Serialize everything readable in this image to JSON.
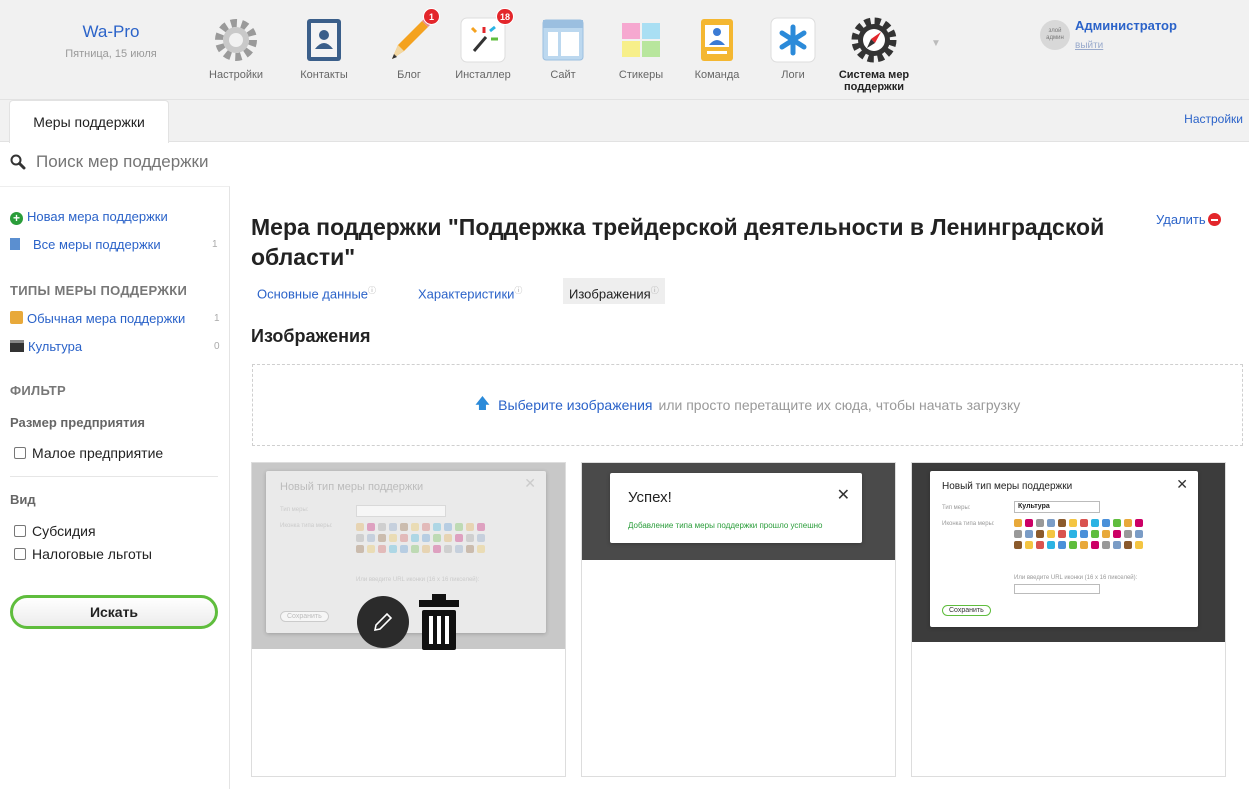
{
  "header": {
    "brand_name": "Wa-Pro",
    "date": "Пятница, 15 июля",
    "apps": [
      {
        "label": "Настройки",
        "icon": "gear-icon"
      },
      {
        "label": "Контакты",
        "icon": "contacts-book-icon"
      },
      {
        "label": "Блог",
        "icon": "pencil-icon",
        "badge": "1"
      },
      {
        "label": "Инсталлер",
        "icon": "installer-sparkle-icon",
        "badge": "18"
      },
      {
        "label": "Сайт",
        "icon": "site-window-icon"
      },
      {
        "label": "Стикеры",
        "icon": "stickers-icon"
      },
      {
        "label": "Команда",
        "icon": "team-badge-icon"
      },
      {
        "label": "Логи",
        "icon": "logs-asterisk-icon"
      },
      {
        "label": "Система мер поддержки",
        "icon": "compass-gear-icon",
        "active": true
      }
    ],
    "user": {
      "avatar_text": "злой админ",
      "name": "Администратор",
      "logout": "выйти"
    }
  },
  "tabs": {
    "app_tab": "Меры поддержки",
    "settings": "Настройки"
  },
  "search": {
    "placeholder": "Поиск мер поддержки"
  },
  "sidebar": {
    "new_measure": "Новая мера поддержки",
    "all_measures": "Все меры поддержки",
    "all_measures_count": "1",
    "types_heading": "ТИПЫ МЕРЫ ПОДДЕРЖКИ",
    "types": [
      {
        "label": "Обычная мера поддержки",
        "count": "1"
      },
      {
        "label": "Культура",
        "count": "0"
      }
    ],
    "filter_heading": "ФИЛЬТР",
    "size_heading": "Размер предприятия",
    "size_options": [
      "Малое предприятие"
    ],
    "kind_heading": "Вид",
    "kind_options": [
      "Субсидия",
      "Налоговые льготы"
    ],
    "find_button": "Искать"
  },
  "main": {
    "title": "Мера поддержки \"Поддержка трейдерской деятельности в Ленинградской области\"",
    "delete_label": "Удалить",
    "subtabs": [
      {
        "label": "Основные данные",
        "active": false
      },
      {
        "label": "Характеристики",
        "active": false
      },
      {
        "label": "Изображения",
        "active": true
      }
    ],
    "section_heading": "Изображения",
    "dropzone": {
      "pick_link": "Выберите изображения",
      "hint": "или просто перетащите их сюда, чтобы начать загрузку"
    },
    "images": [
      {
        "modal_title": "Новый тип меры поддержки",
        "field_label_1": "Тип меры:",
        "field_label_2": "Иконка типа меры:",
        "url_hint": "Или введите URL иконки (16 x 16 пикселей):",
        "save": "Сохранить"
      },
      {
        "modal_title": "Успех!",
        "message": "Добавление типа меры поддержки прошло успешно"
      },
      {
        "modal_title": "Новый тип меры поддержки",
        "field_label_1": "Тип меры:",
        "field_value": "Культура",
        "field_label_2": "Иконка типа меры:",
        "url_hint": "Или введите URL иконки (16 x 16 пикселей):",
        "save": "Сохранить"
      }
    ]
  },
  "colors": {
    "link": "#2b63c9",
    "accent_green": "#5fbd3d",
    "badge_red": "#e3262b"
  }
}
